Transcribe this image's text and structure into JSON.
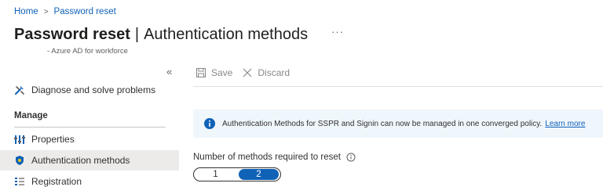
{
  "breadcrumb": {
    "home": "Home",
    "separator": ">",
    "current": "Password reset"
  },
  "title": {
    "main": "Password reset",
    "pipe": "|",
    "section": "Authentication methods",
    "more": "···"
  },
  "subtitle": "- Azure AD for workforce",
  "sidebar": {
    "collapse_glyph": "«",
    "items_top": [
      {
        "label": "Diagnose and solve problems",
        "icon": "wrench-icon"
      }
    ],
    "manage_heading": "Manage",
    "items": [
      {
        "label": "Properties",
        "icon": "properties-icon"
      },
      {
        "label": "Authentication methods",
        "icon": "shield-icon",
        "active": true
      },
      {
        "label": "Registration",
        "icon": "registration-icon"
      }
    ]
  },
  "toolbar": {
    "save_label": "Save",
    "discard_label": "Discard"
  },
  "infobar": {
    "text": "Authentication Methods for SSPR and Signin can now be managed in one converged policy.",
    "link": "Learn more"
  },
  "methods": {
    "label": "Number of methods required to reset",
    "options": [
      "1",
      "2"
    ],
    "selected": "2"
  },
  "colors": {
    "accent": "#0f62b6",
    "info_bg": "#eff6fc",
    "active_nav": "#edebe9"
  }
}
